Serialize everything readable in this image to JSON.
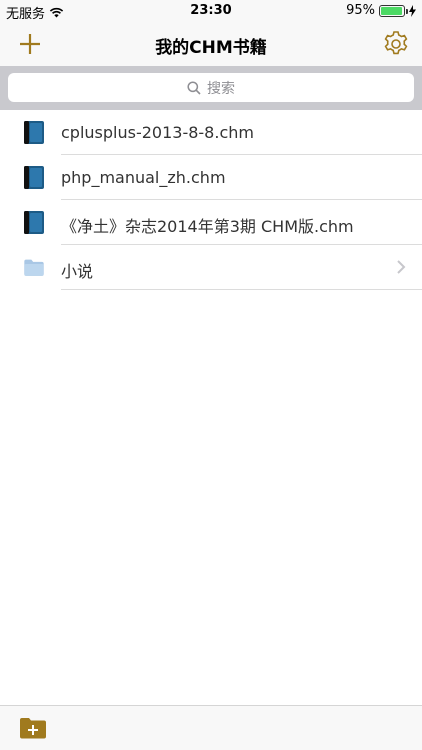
{
  "status_bar": {
    "carrier": "无服务",
    "time": "23:30",
    "battery": "95%",
    "battery_level": 0.95
  },
  "nav": {
    "title": "我的CHM书籍",
    "add_icon": "plus-icon",
    "settings_icon": "gear-icon"
  },
  "search": {
    "placeholder": "搜索"
  },
  "items": [
    {
      "label": "cplusplus-2013-8-8.chm",
      "type": "book",
      "icon": "book-icon"
    },
    {
      "label": "php_manual_zh.chm",
      "type": "book",
      "icon": "book-icon"
    },
    {
      "label": "《净土》杂志2014年第3期 CHM版.chm",
      "type": "book",
      "icon": "book-icon"
    },
    {
      "label": "小说",
      "type": "folder",
      "icon": "folder-icon"
    }
  ],
  "toolbar": {
    "new_folder_icon": "add-folder-icon"
  },
  "colors": {
    "accent": "#a07a1e",
    "book_blue": "#1d5b86",
    "folder_blue": "#a9c7e5"
  }
}
